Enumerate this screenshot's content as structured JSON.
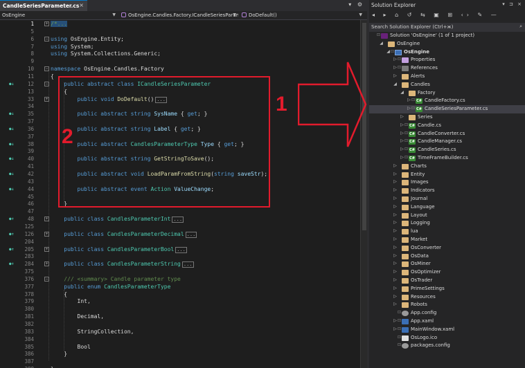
{
  "editor": {
    "tab_title": "CandleSeriesParameter.cs",
    "tab_close": "×",
    "tab_tools": "▾ ⚙",
    "nav": {
      "project": "OsEngine",
      "type": "OsEngine.Candles.Factory.ICandleSeriesParame",
      "member": "DoDefault()"
    },
    "lines": [
      {
        "n": "1",
        "fold": "+",
        "current": true,
        "segments": [
          {
            "c": "cmt-sel",
            "t": "/*..."
          }
        ]
      },
      {
        "n": "5",
        "fold": "",
        "segments": []
      },
      {
        "n": "6",
        "fold": "-",
        "segments": [
          {
            "c": "kw",
            "t": "using "
          },
          {
            "c": "tx",
            "t": "OsEngine.Entity;"
          }
        ]
      },
      {
        "n": "7",
        "fold": "",
        "segments": [
          {
            "c": "kw",
            "t": "using "
          },
          {
            "c": "tx",
            "t": "System;"
          }
        ]
      },
      {
        "n": "8",
        "fold": "",
        "segments": [
          {
            "c": "kw",
            "t": "using "
          },
          {
            "c": "tx",
            "t": "System.Collections.Generic;"
          }
        ]
      },
      {
        "n": "9",
        "fold": "",
        "segments": []
      },
      {
        "n": "10",
        "fold": "-",
        "segments": [
          {
            "c": "kw",
            "t": "namespace "
          },
          {
            "c": "tx",
            "t": "OsEngine.Candles.Factory"
          }
        ]
      },
      {
        "n": "11",
        "fold": "",
        "segments": [
          {
            "c": "tx",
            "t": "{"
          }
        ]
      },
      {
        "n": "12",
        "fold": "-",
        "ovr": "●↓",
        "segments": [
          {
            "c": "tx",
            "t": "    "
          },
          {
            "c": "kw",
            "t": "public abstract class "
          },
          {
            "c": "ty",
            "t": "ICandleSeriesParameter"
          }
        ]
      },
      {
        "n": "13",
        "fold": "",
        "segments": [
          {
            "c": "tx",
            "t": "    {"
          }
        ]
      },
      {
        "n": "33",
        "fold": "+",
        "segments": [
          {
            "c": "tx",
            "t": "        "
          },
          {
            "c": "kw",
            "t": "public void "
          },
          {
            "c": "fn",
            "t": "DoDefault"
          },
          {
            "c": "tx",
            "t": "()"
          }
        ],
        "collapsed": "..."
      },
      {
        "n": "34",
        "fold": "",
        "segments": []
      },
      {
        "n": "35",
        "fold": "",
        "ovr": "●↓",
        "segments": [
          {
            "c": "tx",
            "t": "        "
          },
          {
            "c": "kw",
            "t": "public abstract string "
          },
          {
            "c": "pr",
            "t": "SysName "
          },
          {
            "c": "tx",
            "t": "{ "
          },
          {
            "c": "kw",
            "t": "get"
          },
          {
            "c": "tx",
            "t": "; }"
          }
        ]
      },
      {
        "n": "37",
        "fold": "",
        "segments": []
      },
      {
        "n": "36",
        "fold": "",
        "ovr": "●↓",
        "segments": [
          {
            "c": "tx",
            "t": "        "
          },
          {
            "c": "kw",
            "t": "public abstract string "
          },
          {
            "c": "pr",
            "t": "Label "
          },
          {
            "c": "tx",
            "t": "{ "
          },
          {
            "c": "kw",
            "t": "get"
          },
          {
            "c": "tx",
            "t": "; }"
          }
        ]
      },
      {
        "n": "37",
        "fold": "",
        "segments": []
      },
      {
        "n": "38",
        "fold": "",
        "ovr": "●↓",
        "segments": [
          {
            "c": "tx",
            "t": "        "
          },
          {
            "c": "kw",
            "t": "public abstract "
          },
          {
            "c": "ty",
            "t": "CandlesParameterType "
          },
          {
            "c": "pr",
            "t": "Type "
          },
          {
            "c": "tx",
            "t": "{ "
          },
          {
            "c": "kw",
            "t": "get"
          },
          {
            "c": "tx",
            "t": "; }"
          }
        ]
      },
      {
        "n": "39",
        "fold": "",
        "segments": []
      },
      {
        "n": "40",
        "fold": "",
        "ovr": "●↓",
        "segments": [
          {
            "c": "tx",
            "t": "        "
          },
          {
            "c": "kw",
            "t": "public abstract string "
          },
          {
            "c": "fn",
            "t": "GetStringToSave"
          },
          {
            "c": "tx",
            "t": "();"
          }
        ]
      },
      {
        "n": "41",
        "fold": "",
        "segments": []
      },
      {
        "n": "42",
        "fold": "",
        "ovr": "●↓",
        "segments": [
          {
            "c": "tx",
            "t": "        "
          },
          {
            "c": "kw",
            "t": "public abstract void "
          },
          {
            "c": "fn",
            "t": "LoadParamFromString"
          },
          {
            "c": "tx",
            "t": "("
          },
          {
            "c": "kw",
            "t": "string "
          },
          {
            "c": "pr",
            "t": "saveStr"
          },
          {
            "c": "tx",
            "t": ");"
          }
        ]
      },
      {
        "n": "43",
        "fold": "",
        "segments": []
      },
      {
        "n": "44",
        "fold": "",
        "ovr": "●↓",
        "segments": [
          {
            "c": "tx",
            "t": "        "
          },
          {
            "c": "kw",
            "t": "public abstract event "
          },
          {
            "c": "ty",
            "t": "Action "
          },
          {
            "c": "pr",
            "t": "ValueChange"
          },
          {
            "c": "tx",
            "t": ";"
          }
        ]
      },
      {
        "n": "45",
        "fold": "",
        "segments": []
      },
      {
        "n": "46",
        "fold": "",
        "segments": [
          {
            "c": "tx",
            "t": "    }"
          }
        ]
      },
      {
        "n": "47",
        "fold": "",
        "segments": []
      },
      {
        "n": "48",
        "fold": "+",
        "ovr": "●↑",
        "segments": [
          {
            "c": "tx",
            "t": "    "
          },
          {
            "c": "kw",
            "t": "public class "
          },
          {
            "c": "ty",
            "t": "CandlesParameterInt"
          }
        ],
        "collapsed": "..."
      },
      {
        "n": "125",
        "fold": "",
        "segments": []
      },
      {
        "n": "126",
        "fold": "+",
        "ovr": "●↑",
        "segments": [
          {
            "c": "tx",
            "t": "    "
          },
          {
            "c": "kw",
            "t": "public class "
          },
          {
            "c": "ty",
            "t": "CandlesParameterDecimal"
          }
        ],
        "collapsed": "..."
      },
      {
        "n": "204",
        "fold": "",
        "segments": []
      },
      {
        "n": "205",
        "fold": "+",
        "ovr": "●↑",
        "segments": [
          {
            "c": "tx",
            "t": "    "
          },
          {
            "c": "kw",
            "t": "public class "
          },
          {
            "c": "ty",
            "t": "CandlesParameterBool"
          }
        ],
        "collapsed": "..."
      },
      {
        "n": "283",
        "fold": "",
        "segments": []
      },
      {
        "n": "284",
        "fold": "+",
        "ovr": "●↑",
        "segments": [
          {
            "c": "tx",
            "t": "    "
          },
          {
            "c": "kw",
            "t": "public class "
          },
          {
            "c": "ty",
            "t": "CandlesParameterString"
          }
        ],
        "collapsed": "..."
      },
      {
        "n": "375",
        "fold": "",
        "segments": []
      },
      {
        "n": "376",
        "fold": "-",
        "segments": [
          {
            "c": "tx",
            "t": "    "
          },
          {
            "c": "cmg",
            "t": "/// <summary> Candle parameter type"
          }
        ]
      },
      {
        "n": "377",
        "fold": "",
        "segments": [
          {
            "c": "tx",
            "t": "    "
          },
          {
            "c": "kw",
            "t": "public enum "
          },
          {
            "c": "ty",
            "t": "CandlesParameterType"
          }
        ]
      },
      {
        "n": "378",
        "fold": "",
        "segments": [
          {
            "c": "tx",
            "t": "    {"
          }
        ]
      },
      {
        "n": "379",
        "fold": "",
        "segments": [
          {
            "c": "tx",
            "t": "        Int,"
          }
        ]
      },
      {
        "n": "380",
        "fold": "",
        "segments": []
      },
      {
        "n": "381",
        "fold": "",
        "segments": [
          {
            "c": "tx",
            "t": "        Decimal,"
          }
        ]
      },
      {
        "n": "382",
        "fold": "",
        "segments": []
      },
      {
        "n": "383",
        "fold": "",
        "segments": [
          {
            "c": "tx",
            "t": "        StringCollection,"
          }
        ]
      },
      {
        "n": "384",
        "fold": "",
        "segments": []
      },
      {
        "n": "385",
        "fold": "",
        "segments": [
          {
            "c": "tx",
            "t": "        Bool"
          }
        ]
      },
      {
        "n": "386",
        "fold": "",
        "segments": [
          {
            "c": "tx",
            "t": "    }"
          }
        ]
      },
      {
        "n": "387",
        "fold": "",
        "segments": []
      },
      {
        "n": "388",
        "fold": "",
        "segments": [
          {
            "c": "tx",
            "t": "}"
          }
        ]
      }
    ]
  },
  "annotations": {
    "label_1": "1",
    "label_2": "2",
    "color": "#e21b2c"
  },
  "solution_explorer": {
    "title": "Solution Explorer",
    "title_icons": "▾ ⊐ ×",
    "toolbar": "◂ ▸ ⌂ ↺ ⇆ ▣ ⊞ ‹› ✎ —",
    "search_placeholder": "Search Solution Explorer (Ctrl+ж)",
    "search_icon": "⌕",
    "items": [
      {
        "label": "Solution 'OsEngine' (1 of 1 project)",
        "depth": 0,
        "expander": "",
        "icon": "sln",
        "lock": "⊡"
      },
      {
        "label": "OsEngine",
        "depth": 1,
        "expander": "◢",
        "icon": "folder",
        "lock": ""
      },
      {
        "label": "OsEngine",
        "depth": 2,
        "expander": "◢",
        "icon": "proj",
        "lock": "⊡",
        "bold": true
      },
      {
        "label": "Properties",
        "depth": 3,
        "expander": "▷",
        "icon": "wrench",
        "lock": "⊡"
      },
      {
        "label": "References",
        "depth": 3,
        "expander": "▷",
        "icon": "refs",
        "lock": "⊡"
      },
      {
        "label": "Alerts",
        "depth": 3,
        "expander": "▷",
        "icon": "folder",
        "lock": ""
      },
      {
        "label": "Candles",
        "depth": 3,
        "expander": "◢",
        "icon": "folder",
        "lock": ""
      },
      {
        "label": "Factory",
        "depth": 4,
        "expander": "◢",
        "icon": "folder",
        "lock": ""
      },
      {
        "label": "CandleFactory.cs",
        "depth": 5,
        "expander": "▷",
        "icon": "cs",
        "lock": "⊡"
      },
      {
        "label": "CandleSeriesParameter.cs",
        "depth": 5,
        "expander": "▷",
        "icon": "cs",
        "lock": "⊡",
        "selected": true
      },
      {
        "label": "Series",
        "depth": 4,
        "expander": "▷",
        "icon": "folder",
        "lock": ""
      },
      {
        "label": "Candle.cs",
        "depth": 4,
        "expander": "▷",
        "icon": "cs",
        "lock": "⊡"
      },
      {
        "label": "CandleConverter.cs",
        "depth": 4,
        "expander": "▷",
        "icon": "cs",
        "lock": "⊡"
      },
      {
        "label": "CandleManager.cs",
        "depth": 4,
        "expander": "▷",
        "icon": "cs",
        "lock": "⊡"
      },
      {
        "label": "CandleSeries.cs",
        "depth": 4,
        "expander": "▷",
        "icon": "cs",
        "lock": "⊡"
      },
      {
        "label": "TimeFrameBuilder.cs",
        "depth": 4,
        "expander": "▷",
        "icon": "cs",
        "lock": "⊡"
      },
      {
        "label": "Charts",
        "depth": 3,
        "expander": "▷",
        "icon": "folder",
        "lock": ""
      },
      {
        "label": "Entity",
        "depth": 3,
        "expander": "▷",
        "icon": "folder",
        "lock": ""
      },
      {
        "label": "Images",
        "depth": 3,
        "expander": "▷",
        "icon": "folder",
        "lock": ""
      },
      {
        "label": "Indicators",
        "depth": 3,
        "expander": "▷",
        "icon": "folder",
        "lock": ""
      },
      {
        "label": "Journal",
        "depth": 3,
        "expander": "▷",
        "icon": "folder",
        "lock": ""
      },
      {
        "label": "Language",
        "depth": 3,
        "expander": "▷",
        "icon": "folder",
        "lock": ""
      },
      {
        "label": "Layout",
        "depth": 3,
        "expander": "▷",
        "icon": "folder",
        "lock": ""
      },
      {
        "label": "Logging",
        "depth": 3,
        "expander": "▷",
        "icon": "folder",
        "lock": ""
      },
      {
        "label": "lua",
        "depth": 3,
        "expander": "▷",
        "icon": "folder",
        "lock": ""
      },
      {
        "label": "Market",
        "depth": 3,
        "expander": "▷",
        "icon": "folder",
        "lock": ""
      },
      {
        "label": "OsConverter",
        "depth": 3,
        "expander": "▷",
        "icon": "folder",
        "lock": ""
      },
      {
        "label": "OsData",
        "depth": 3,
        "expander": "▷",
        "icon": "folder",
        "lock": ""
      },
      {
        "label": "OsMiner",
        "depth": 3,
        "expander": "▷",
        "icon": "folder",
        "lock": ""
      },
      {
        "label": "OsOptimizer",
        "depth": 3,
        "expander": "▷",
        "icon": "folder",
        "lock": ""
      },
      {
        "label": "OsTrader",
        "depth": 3,
        "expander": "▷",
        "icon": "folder",
        "lock": ""
      },
      {
        "label": "PrimeSettings",
        "depth": 3,
        "expander": "▷",
        "icon": "folder",
        "lock": ""
      },
      {
        "label": "Resources",
        "depth": 3,
        "expander": "▷",
        "icon": "folder",
        "lock": ""
      },
      {
        "label": "Robots",
        "depth": 3,
        "expander": "▷",
        "icon": "folder",
        "lock": ""
      },
      {
        "label": "App.config",
        "depth": 3,
        "expander": "",
        "icon": "gear",
        "lock": "⊡"
      },
      {
        "label": "App.xaml",
        "depth": 3,
        "expander": "▷",
        "icon": "xaml",
        "lock": "⊡"
      },
      {
        "label": "MainWindow.xaml",
        "depth": 3,
        "expander": "▷",
        "icon": "xaml",
        "lock": "⊡"
      },
      {
        "label": "OsLogo.ico",
        "depth": 3,
        "expander": "",
        "icon": "file",
        "lock": "⊡"
      },
      {
        "label": "packages.config",
        "depth": 3,
        "expander": "",
        "icon": "gear",
        "lock": "⊡"
      }
    ]
  }
}
